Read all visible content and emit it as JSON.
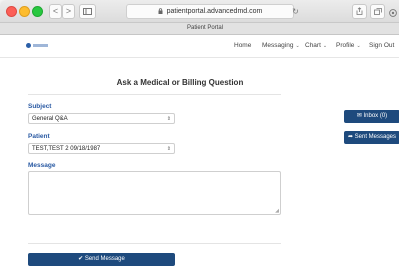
{
  "browser": {
    "url": "patientportal.advancedmd.com",
    "tab_title": "Patient Portal",
    "back_glyph": "<",
    "forward_glyph": ">",
    "reload_glyph": "↻"
  },
  "nav": {
    "home": "Home",
    "messaging": "Messaging",
    "chart": "Chart",
    "profile": "Profile",
    "sign_out": "Sign Out",
    "caret_glyph": "⌄"
  },
  "form": {
    "heading": "Ask a Medical or Billing Question",
    "subject_label": "Subject",
    "subject_value": "General Q&A",
    "patient_label": "Patient",
    "patient_value": "TEST,TEST 2 09/18/1987",
    "message_label": "Message",
    "message_value": "",
    "select_arrow": "⇕",
    "send_button": "✔ Send Message"
  },
  "sidebar": {
    "inbox": "✉ Inbox (0)",
    "sent": "➦ Sent Messages"
  },
  "colors": {
    "accent": "#1e4a7d",
    "label": "#2a5aa3"
  }
}
